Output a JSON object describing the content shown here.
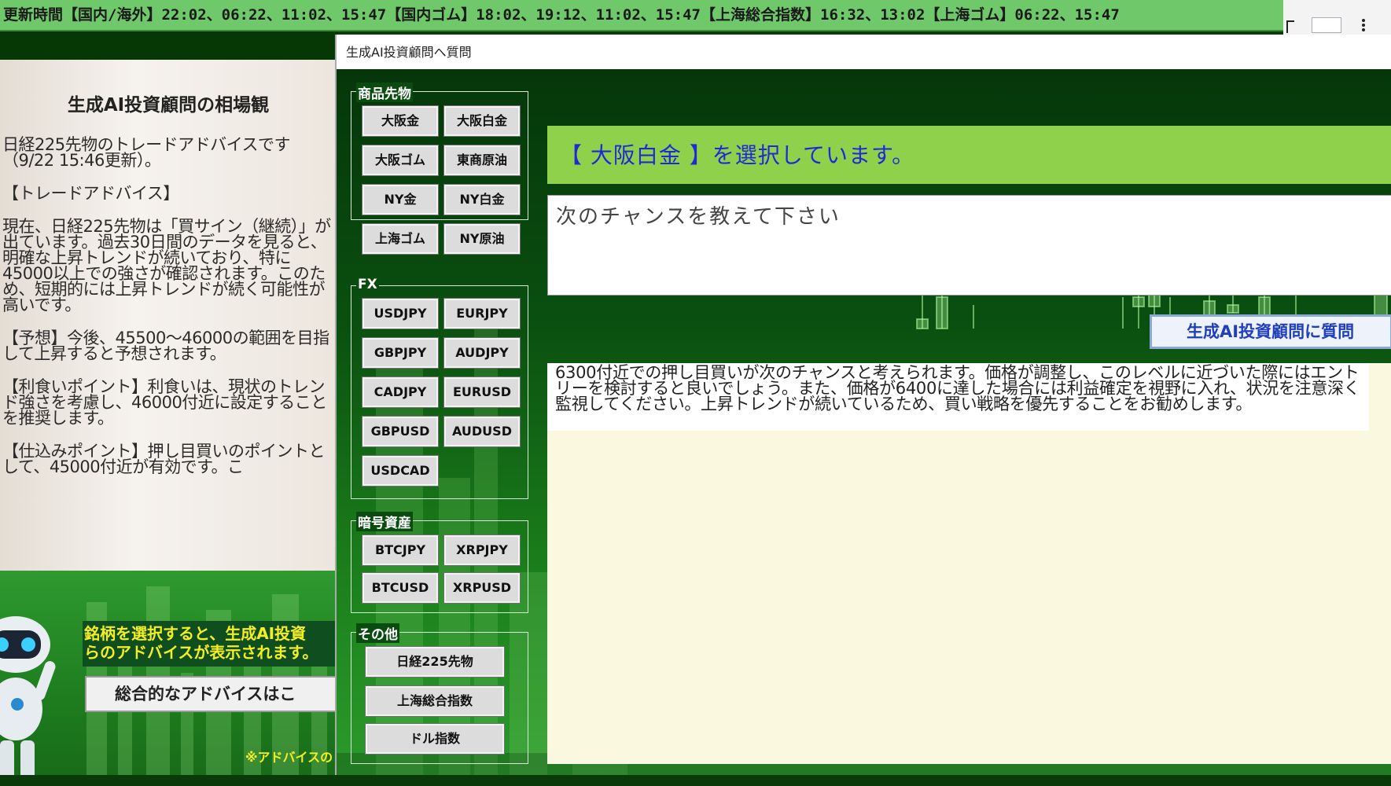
{
  "ticker": {
    "text": "更新時間【国内/海外】22:02、06:22、11:02、15:47【国内ゴム】18:02、19:12、11:02、15:47【上海総合指数】16:32、13:02【上海ゴム】06:22、15:47"
  },
  "left_panel": {
    "title": "生成AI投資顧問の相場観",
    "paragraphs": [
      "日経225先物のトレードアドバイスです（9/22 15:46更新）。",
      "【トレードアドバイス】",
      "現在、日経225先物は「買サイン（継続）」が出ています。過去30日間のデータを見ると、明確な上昇トレンドが続いており、特に45000以上での強さが確認されます。このため、短期的には上昇トレンドが続く可能性が高いです。",
      "【予想】今後、45500〜46000の範囲を目指して上昇すると予想されます。",
      "【利食いポイント】利食いは、現状のトレンド強さを考慮し、46000付近に設定することを推奨します。",
      "【仕込みポイント】押し目買いのポイントとして、45000付近が有効です。こ"
    ],
    "promo_text_1": "銘柄を選択すると、生成AI投資",
    "promo_text_2": "らのアドバイスが表示されます。",
    "overall_button": "総合的なアドバイスはこ",
    "promo_note": "※アドバイスの"
  },
  "dialog": {
    "title": "生成AI投資顧問へ質問",
    "groups": {
      "commodities": {
        "label": "商品先物",
        "buttons": [
          "大阪金",
          "大阪白金",
          "大阪ゴム",
          "東商原油",
          "NY金",
          "NY白金",
          "上海ゴム",
          "NY原油"
        ]
      },
      "fx": {
        "label": "FX",
        "buttons": [
          "USDJPY",
          "EURJPY",
          "GBPJPY",
          "AUDJPY",
          "CADJPY",
          "EURUSD",
          "GBPUSD",
          "AUDUSD",
          "USDCAD"
        ]
      },
      "crypto": {
        "label": "暗号資産",
        "buttons": [
          "BTCJPY",
          "XRPJPY",
          "BTCUSD",
          "XRPUSD"
        ]
      },
      "other": {
        "label": "その他",
        "buttons": [
          "日経225先物",
          "上海総合指数",
          "ドル指数"
        ]
      }
    },
    "selected_text": "【 大阪白金 】を選択しています。",
    "question_value": "次のチャンスを教えて下さい",
    "ask_button": "生成AI投資顧問に質問",
    "answer": "6300付近での押し目買いが次のチャンスと考えられます。価格が調整し、このレベルに近づいた際にはエントリーを検討すると良いでしょう。また、価格が6400に達した場合には利益確定を視野に入れ、状況を注意深く監視してください。上昇トレンドが続いているため、買い戦略を優先することをお勧めします。"
  },
  "colors": {
    "ticker_bg": "#6fc86a",
    "selected_bar": "#8fd14a",
    "selected_text": "#1f2ad6",
    "promo_text": "#f4ee22",
    "answer_bg": "#fbf8e0"
  }
}
